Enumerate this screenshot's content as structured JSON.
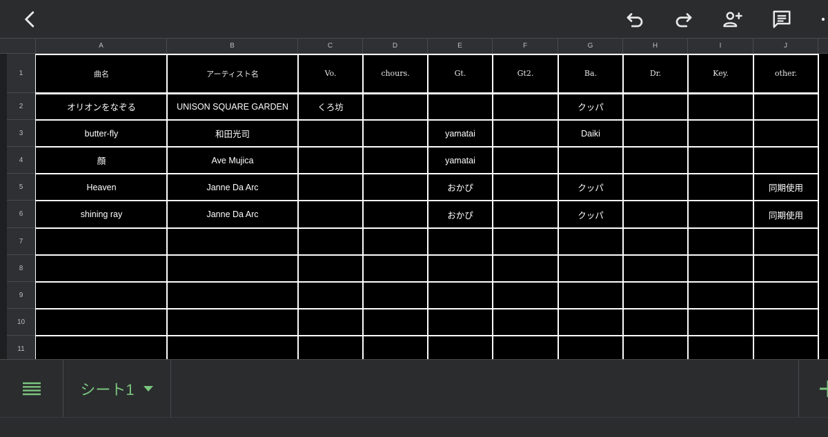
{
  "toolbar": {
    "icons": [
      "chevron-left-icon",
      "undo-icon",
      "redo-icon",
      "person-add-icon",
      "comment-icon",
      "more-vert-icon"
    ]
  },
  "sheet": {
    "columns": [
      "A",
      "B",
      "C",
      "D",
      "E",
      "F",
      "G",
      "H",
      "I",
      "J"
    ],
    "rows": [
      "1",
      "2",
      "3",
      "4",
      "5",
      "6",
      "7",
      "8",
      "9",
      "10",
      "11"
    ],
    "cells": [
      [
        "曲名",
        "アーティスト名",
        "Vo.",
        "chours.",
        "Gt.",
        "Gt2.",
        "Ba.",
        "Dr.",
        "Key.",
        "other."
      ],
      [
        "オリオンをなぞる",
        "UNISON SQUARE GARDEN",
        "くろ坊",
        "",
        "",
        "",
        "クッパ",
        "",
        "",
        ""
      ],
      [
        "butter-fly",
        "和田光司",
        "",
        "",
        "yamatai",
        "",
        "Daiki",
        "",
        "",
        ""
      ],
      [
        "顔",
        "Ave Mujica",
        "",
        "",
        "yamatai",
        "",
        "",
        "",
        "",
        ""
      ],
      [
        "Heaven",
        "Janne Da Arc",
        "",
        "",
        "おかぴ",
        "",
        "クッパ",
        "",
        "",
        "同期使用"
      ],
      [
        "shining ray",
        "Janne Da Arc",
        "",
        "",
        "おかぴ",
        "",
        "クッパ",
        "",
        "",
        "同期使用"
      ],
      [
        "",
        "",
        "",
        "",
        "",
        "",
        "",
        "",
        "",
        ""
      ],
      [
        "",
        "",
        "",
        "",
        "",
        "",
        "",
        "",
        "",
        ""
      ],
      [
        "",
        "",
        "",
        "",
        "",
        "",
        "",
        "",
        "",
        ""
      ],
      [
        "",
        "",
        "",
        "",
        "",
        "",
        "",
        "",
        "",
        ""
      ],
      [
        "",
        "",
        "",
        "",
        "",
        "",
        "",
        "",
        "",
        ""
      ]
    ]
  },
  "bottom_bar": {
    "sheet_tab_label": "シート1",
    "icons": [
      "menu-icon",
      "dropdown-arrow-icon",
      "add-sheet-icon"
    ]
  },
  "colors": {
    "accent": "#7bc67e",
    "toolbar_bg": "#2b2c2e",
    "header_bg": "#2f3033",
    "cell_bg": "#000000",
    "gridline": "#ffffff"
  }
}
